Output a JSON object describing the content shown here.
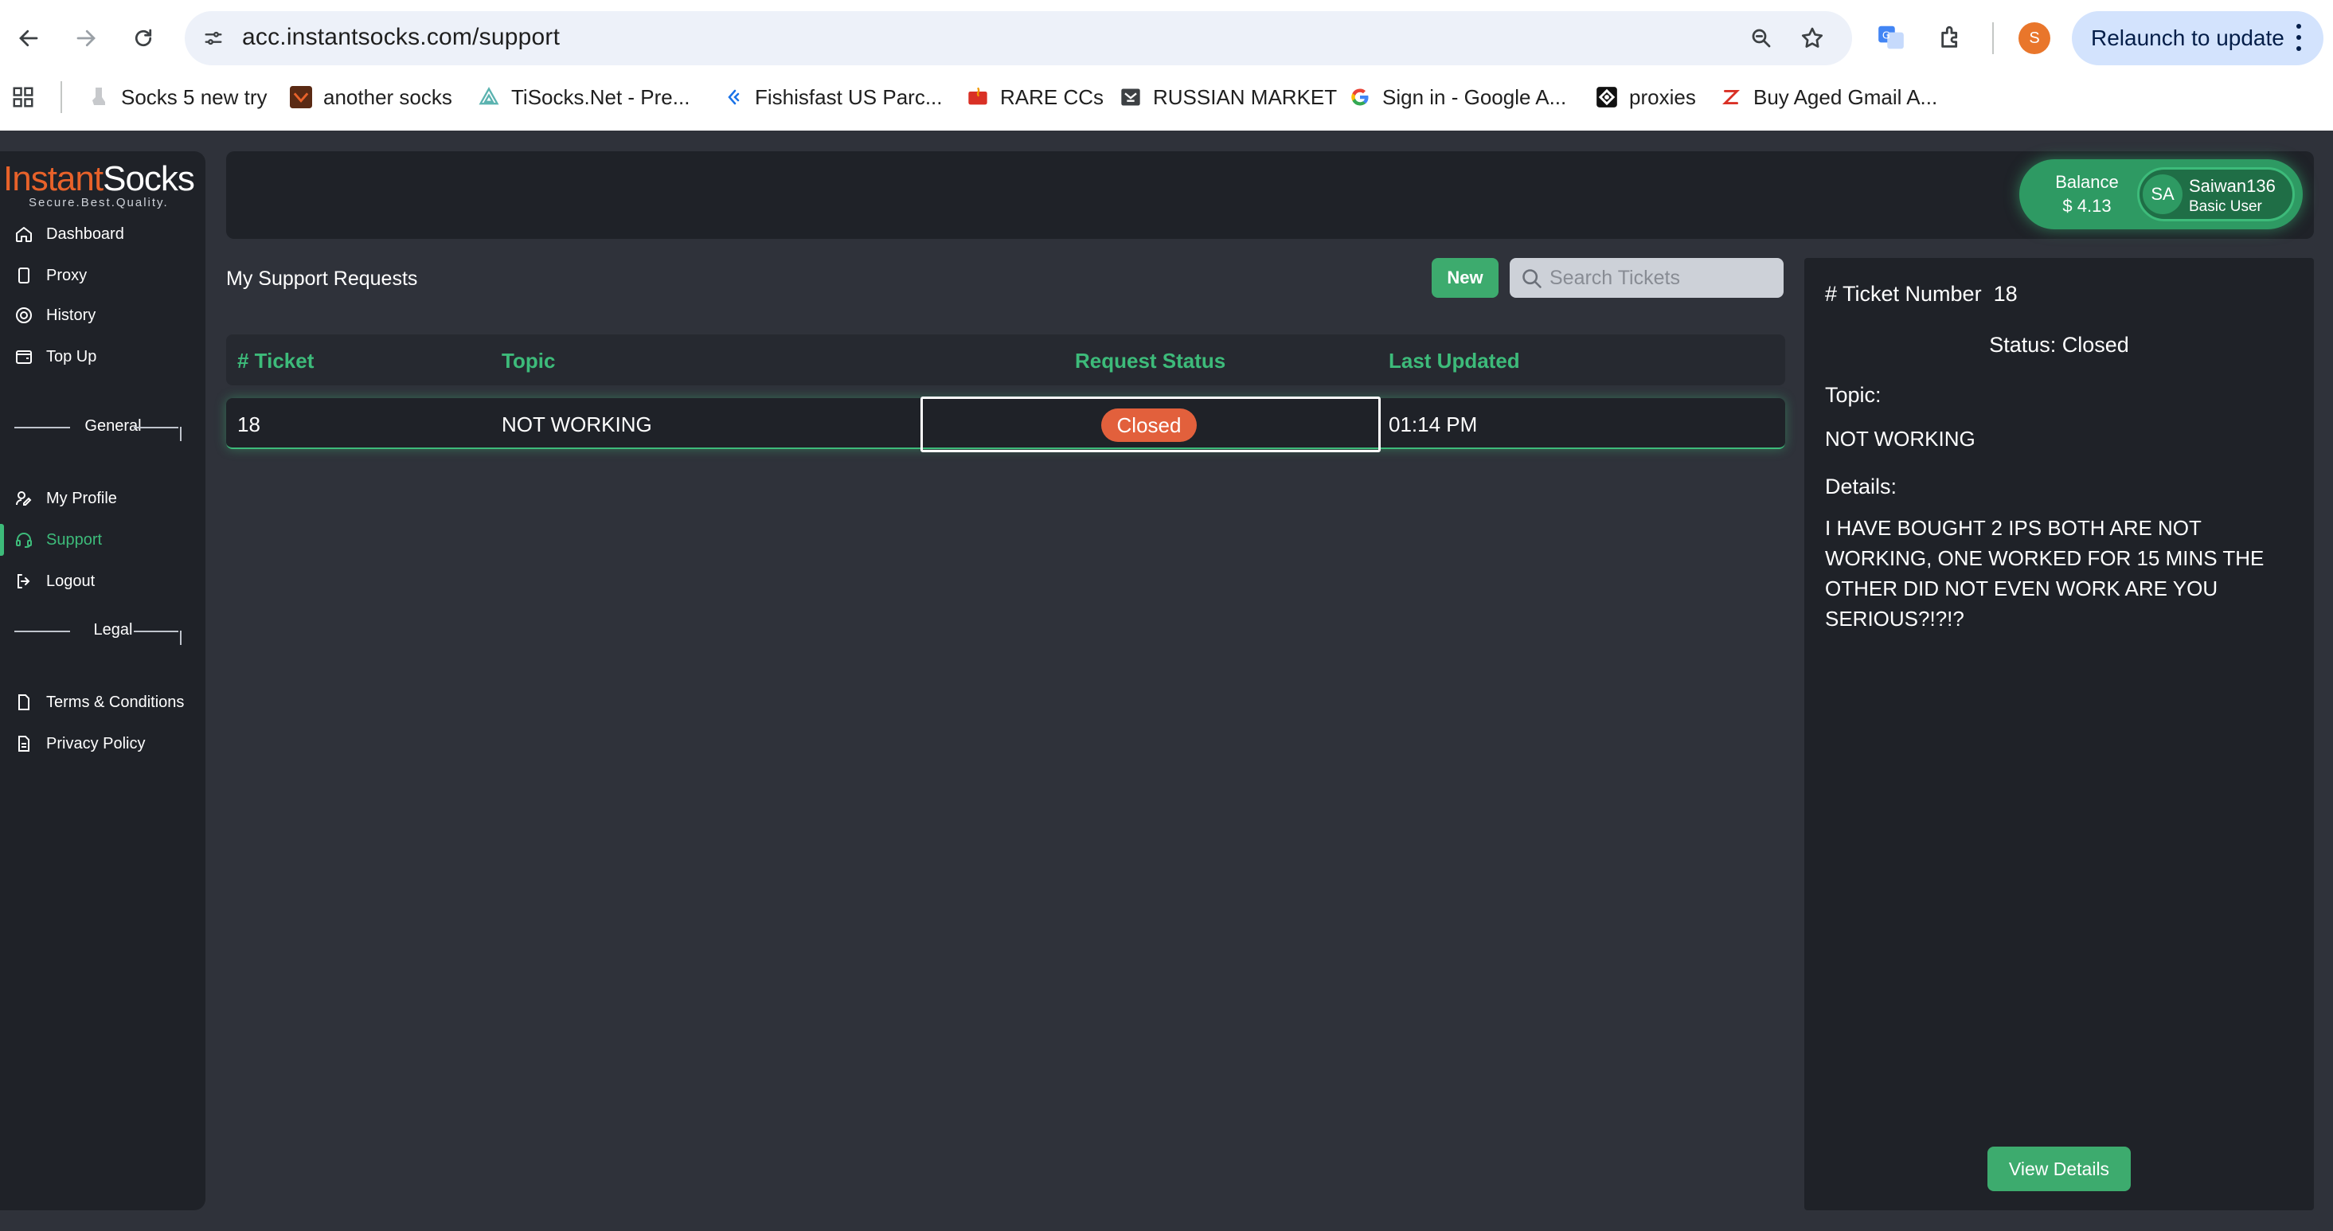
{
  "browser": {
    "url": "acc.instantsocks.com/support",
    "relaunch_label": "Relaunch to update",
    "profile_initial": "S",
    "bookmarks": [
      {
        "label": "Socks 5 new try"
      },
      {
        "label": "another socks"
      },
      {
        "label": "TiSocks.Net - Pre..."
      },
      {
        "label": "Fishisfast US Parc..."
      },
      {
        "label": "RARE CCs"
      },
      {
        "label": "RUSSIAN MARKET"
      },
      {
        "label": "Sign in - Google A..."
      },
      {
        "label": "proxies"
      },
      {
        "label": "Buy Aged Gmail A..."
      }
    ]
  },
  "logo": {
    "brand_left": "Instant",
    "brand_right": "Socks",
    "tagline": "Secure.Best.Quality."
  },
  "sidebar": {
    "items": [
      {
        "label": "Dashboard"
      },
      {
        "label": "Proxy"
      },
      {
        "label": "History"
      },
      {
        "label": "Top Up"
      }
    ],
    "general_label": "General",
    "general_items": [
      {
        "label": "My Profile"
      },
      {
        "label": "Support"
      },
      {
        "label": "Logout"
      }
    ],
    "legal_label": "Legal",
    "legal_items": [
      {
        "label": "Terms & Conditions"
      },
      {
        "label": "Privacy Policy"
      }
    ],
    "active_color": "#3dbb7a"
  },
  "user": {
    "balance_label": "Balance",
    "balance_value": "$ 4.13",
    "initials": "SA",
    "name": "Saiwan136",
    "role": "Basic User"
  },
  "main": {
    "title": "My Support Requests",
    "new_label": "New",
    "search_placeholder": "Search Tickets",
    "columns": [
      "# Ticket",
      "Topic",
      "Request Status",
      "Last Updated"
    ],
    "rows": [
      {
        "ticket": "18",
        "topic": "NOT WORKING",
        "status": "Closed",
        "updated": "01:14 PM"
      }
    ]
  },
  "detail": {
    "ticket_label": "# Ticket Number",
    "ticket_number": "18",
    "status_text": "Status: Closed",
    "topic_label": "Topic:",
    "topic_value": "NOT WORKING",
    "details_label": "Details:",
    "details_value": "I HAVE BOUGHT 2 IPS BOTH ARE NOT WORKING, ONE WORKED FOR 15 MINS THE OTHER DID NOT EVEN WORK ARE YOU SERIOUS?!?!?",
    "view_label": "View Details"
  },
  "colors": {
    "accent": "#3dbb7a",
    "badge_closed": "#e2603c",
    "brand": "#e8622a",
    "panel": "#1f2228",
    "background": "#2f323a"
  }
}
